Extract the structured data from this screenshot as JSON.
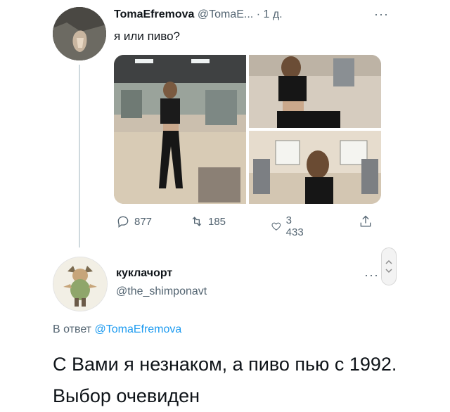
{
  "tweet": {
    "author_name": "TomaEfremova",
    "author_handle": "@TomaE...",
    "separator": "·",
    "time": "1 д.",
    "more": "···",
    "text": "я или пиво?",
    "stats": {
      "replies": "877",
      "retweets": "185",
      "likes": "3 433"
    }
  },
  "reply": {
    "author_name": "куклачорт",
    "author_handle": "@the_shimponavt",
    "more": "···",
    "reply_prefix": "В ответ",
    "reply_target": "@TomaEfremova",
    "text": "С Вами я незнаком, а пиво пью с 1992. Выбор очевиден"
  },
  "icons": [
    "reply-icon",
    "retweet-icon",
    "like-icon",
    "share-icon",
    "more-icon"
  ],
  "colors": {
    "link": "#1d9bf0",
    "muted": "#536471",
    "text": "#0f1419",
    "thread_line": "#cfd9de"
  }
}
